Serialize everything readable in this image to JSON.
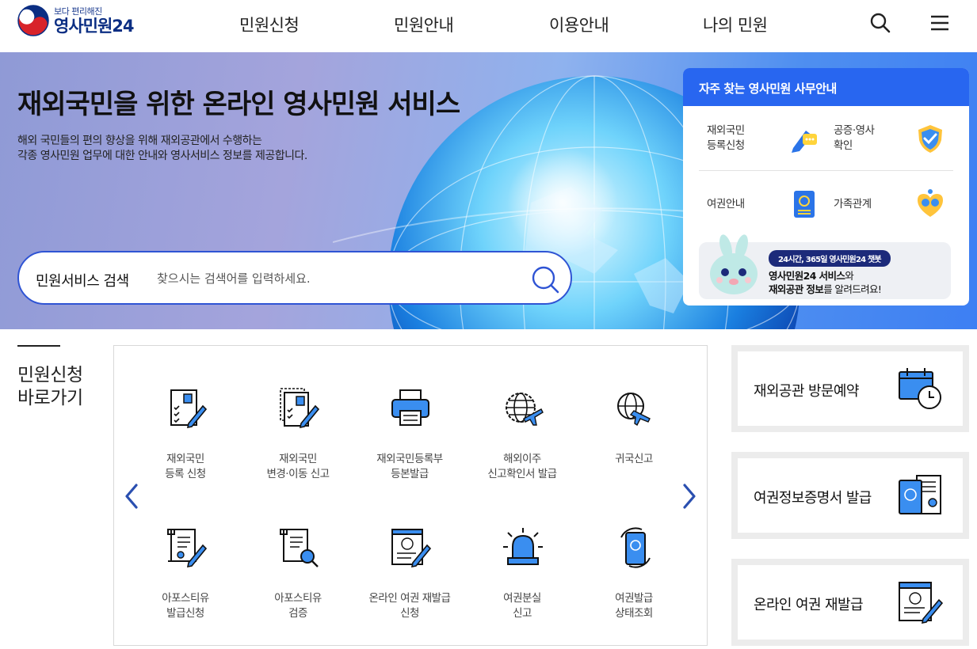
{
  "header": {
    "logo_sub": "보다 편리해진",
    "logo_main": "영사민원24",
    "nav": [
      "민원신청",
      "민원안내",
      "이용안내",
      "나의 민원"
    ]
  },
  "hero": {
    "title": "재외국민을 위한 온라인 영사민원 서비스",
    "desc_line1": "해외 국민들의 편의 향상을 위해 재외공관에서 수행하는",
    "desc_line2": "각종 영사민원 업무에 대한 안내와 영사서비스 정보를 제공합니다."
  },
  "search": {
    "label": "민원서비스 검색",
    "placeholder": "찾으시는 검색어를 입력하세요."
  },
  "guide": {
    "title": "자주 찾는 영사민원 사무안내",
    "items": [
      {
        "line1": "재외국민",
        "line2": "등록신청"
      },
      {
        "line1": "공증·영사",
        "line2": "확인"
      },
      {
        "line1": "여권안내",
        "line2": ""
      },
      {
        "line1": "가족관계",
        "line2": ""
      }
    ],
    "chatbot": {
      "badge": "24시간, 365일 영사민원24 챗봇",
      "l1_bold": "영사민원24 서비스",
      "l1_rest": "와",
      "l2_bold": "재외공관 정보",
      "l2_rest": "를 알려드려요!"
    }
  },
  "quick": {
    "title_line1": "민원신청",
    "title_line2": "바로가기",
    "items": [
      {
        "line1": "재외국민",
        "line2": "등록 신청"
      },
      {
        "line1": "재외국민",
        "line2": "변경·이동 신고"
      },
      {
        "line1": "재외국민등록부",
        "line2": "등본발급"
      },
      {
        "line1": "해외이주",
        "line2": "신고확인서 발급"
      },
      {
        "line1": "귀국신고",
        "line2": ""
      },
      {
        "line1": "아포스티유",
        "line2": "발급신청"
      },
      {
        "line1": "아포스티유",
        "line2": "검증"
      },
      {
        "line1": "온라인 여권 재발급",
        "line2": "신청"
      },
      {
        "line1": "여권분실",
        "line2": "신고"
      },
      {
        "line1": "여권발급",
        "line2": "상태조회"
      }
    ]
  },
  "cards": [
    "재외공관 방문예약",
    "여권정보증명서 발급",
    "온라인 여권 재발급"
  ],
  "colors": {
    "primary": "#2866f0",
    "navy": "#1c2a7a",
    "accent": "#1f9be6"
  }
}
